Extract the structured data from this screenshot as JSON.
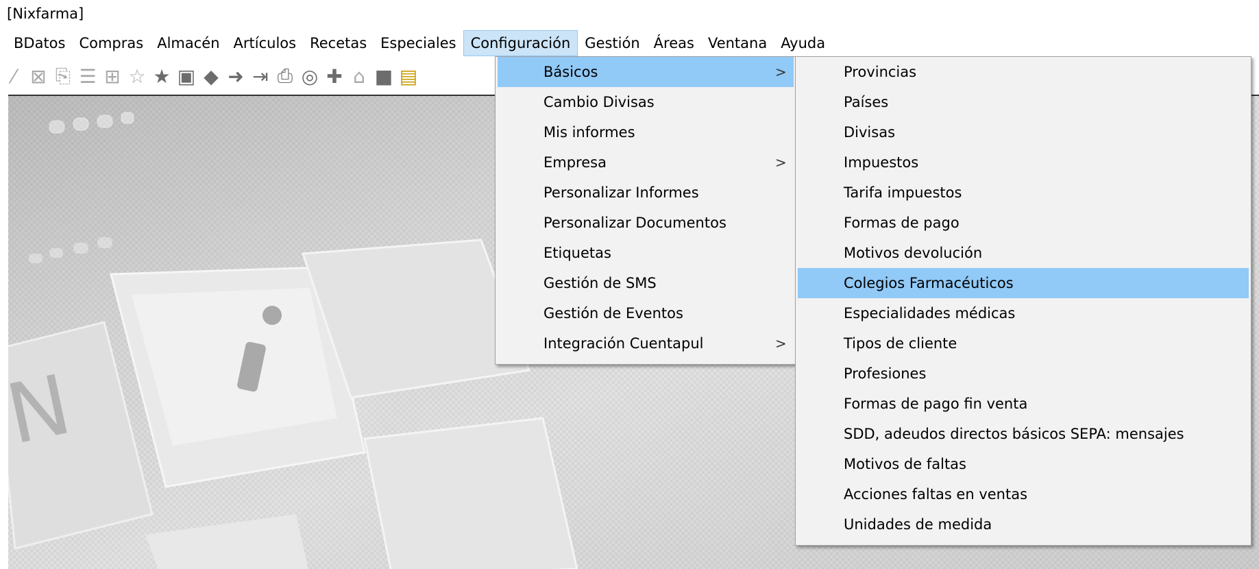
{
  "window": {
    "title": "[Nixfarma]"
  },
  "menubar": [
    "BDatos",
    "Compras",
    "Almacén",
    "Artículos",
    "Recetas",
    "Especiales",
    "Configuración",
    "Gestión",
    "Áreas",
    "Ventana",
    "Ayuda"
  ],
  "toolbar_icons": [
    "check-icon",
    "close-box-icon",
    "document-icon",
    "list-icon",
    "table-icon",
    "star-outline-icon",
    "star-filled-icon",
    "export-icon",
    "arrow-left-icon",
    "arrow-right-icon",
    "import-icon",
    "print-icon",
    "search-icon",
    "wand-icon",
    "network-icon",
    "stop-icon",
    "notes-icon"
  ],
  "config_menu": {
    "items": [
      {
        "label": "Básicos",
        "submenu": true,
        "highlighted": true
      },
      {
        "label": "Cambio Divisas",
        "submenu": false
      },
      {
        "label": "Mis informes",
        "submenu": false
      },
      {
        "label": "Empresa",
        "submenu": true
      },
      {
        "label": "Personalizar Informes",
        "submenu": false
      },
      {
        "label": "Personalizar Documentos",
        "submenu": false
      },
      {
        "label": "Etiquetas",
        "submenu": false
      },
      {
        "label": "Gestión de SMS",
        "submenu": false
      },
      {
        "label": "Gestión de Eventos",
        "submenu": false
      },
      {
        "label": "Integración Cuentapul",
        "submenu": true
      }
    ],
    "arrow": ">"
  },
  "basicos_menu": {
    "items": [
      {
        "label": "Provincias"
      },
      {
        "label": "Países"
      },
      {
        "label": "Divisas"
      },
      {
        "label": "Impuestos"
      },
      {
        "label": "Tarifa impuestos"
      },
      {
        "label": "Formas de pago"
      },
      {
        "label": "Motivos devolución"
      },
      {
        "label": "Colegios Farmacéuticos",
        "highlighted": true
      },
      {
        "label": "Especialidades médicas"
      },
      {
        "label": "Tipos de cliente"
      },
      {
        "label": "Profesiones"
      },
      {
        "label": "Formas de pago fin venta"
      },
      {
        "label": "SDD, adeudos directos básicos SEPA: mensajes"
      },
      {
        "label": "Motivos de faltas"
      },
      {
        "label": "Acciones faltas en ventas"
      },
      {
        "label": "Unidades de medida"
      }
    ]
  },
  "colors": {
    "menu_highlight": "#91c9f7",
    "menubar_open": "#cce4f7",
    "menu_bg": "#f2f2f2"
  }
}
